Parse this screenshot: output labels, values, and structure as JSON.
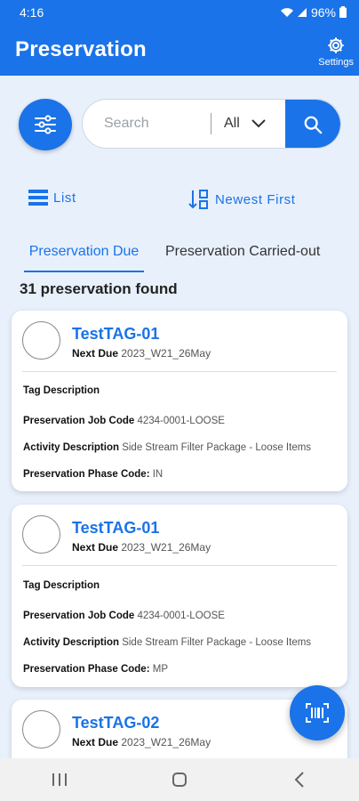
{
  "status_bar": {
    "time": "4:16",
    "battery": "96%"
  },
  "app_bar": {
    "title": "Preservation",
    "settings_label": "Settings"
  },
  "search": {
    "placeholder": "Search",
    "scope": "All"
  },
  "toolbar": {
    "view_label": "List",
    "sort_label": "Newest First"
  },
  "tabs": [
    {
      "label": "Preservation Due",
      "active": true
    },
    {
      "label": "Preservation Carried-out",
      "active": false
    }
  ],
  "result_count": "31 preservation found",
  "labels": {
    "next_due": "Next Due",
    "tag_description": "Tag Description",
    "job_code": "Preservation Job Code",
    "activity": "Activity Description",
    "phase_code": "Preservation Phase Code:"
  },
  "cards": [
    {
      "tag": "TestTAG-01",
      "next_due": "2023_W21_26May",
      "job_code": "4234-0001-LOOSE",
      "activity": "Side Stream Filter Package - Loose Items",
      "phase_code": "IN"
    },
    {
      "tag": "TestTAG-01",
      "next_due": "2023_W21_26May",
      "job_code": "4234-0001-LOOSE",
      "activity": "Side Stream Filter Package - Loose Items",
      "phase_code": "MP"
    },
    {
      "tag": "TestTAG-02",
      "next_due": "2023_W21_26May"
    }
  ],
  "colors": {
    "primary": "#1a73e8",
    "background": "#e8f0fc"
  },
  "icons": [
    "wifi-icon",
    "signal-icon",
    "battery-icon",
    "gear-icon",
    "filter-sliders-icon",
    "chevron-down-icon",
    "search-icon",
    "list-icon",
    "sort-icon",
    "barcode-scan-icon",
    "recents-icon",
    "home-icon",
    "back-icon"
  ]
}
